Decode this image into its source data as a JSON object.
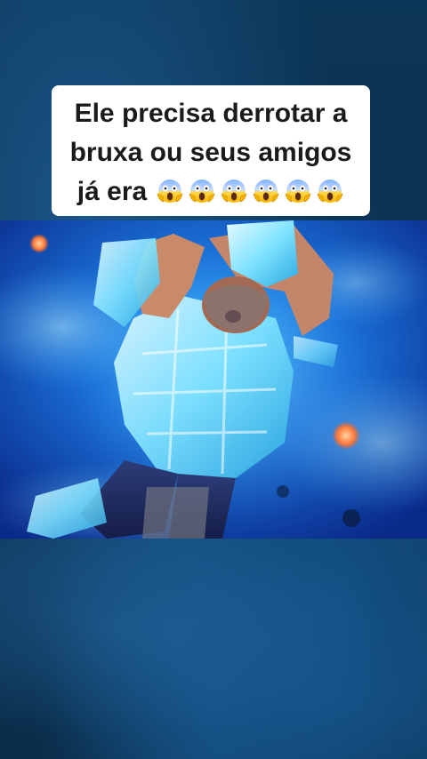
{
  "caption": {
    "lines": [
      "Ele precisa derrotar a",
      "bruxa ou seus amigos",
      "já era"
    ],
    "emoji_icon": "screaming-face-emoji",
    "emoji_count": 6
  },
  "colors": {
    "caption_background": "#ffffff",
    "caption_text": "#1b1b1b",
    "video_glow": "#4fd8ff",
    "page_background": "#0b2a45"
  }
}
